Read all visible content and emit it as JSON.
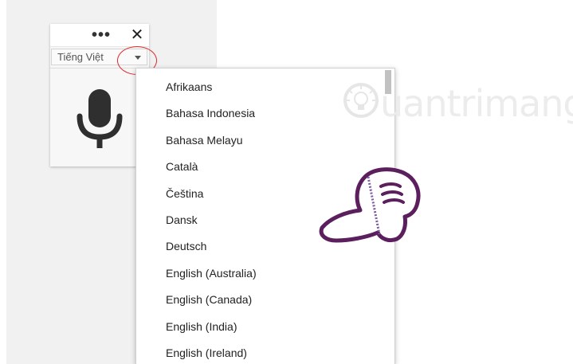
{
  "widget": {
    "menu_icon": "more-horizontal-icon",
    "close_icon": "close-icon",
    "more_glyph": "•••",
    "close_glyph": "✕",
    "language_selected": "Tiếng Việt",
    "mic_icon": "microphone-icon"
  },
  "dropdown": {
    "items": [
      "Afrikaans",
      "Bahasa Indonesia",
      "Bahasa Melayu",
      "Català",
      "Čeština",
      "Dansk",
      "Deutsch",
      "English (Australia)",
      "English (Canada)",
      "English (India)",
      "English (Ireland)"
    ]
  },
  "watermark": {
    "text": "uantrimang",
    "icon": "lightbulb-logo-icon"
  },
  "colors": {
    "highlight_ring": "#e0282a",
    "annotation_hand": "#5b1f5e",
    "panel_bg": "#f1f1f1"
  }
}
